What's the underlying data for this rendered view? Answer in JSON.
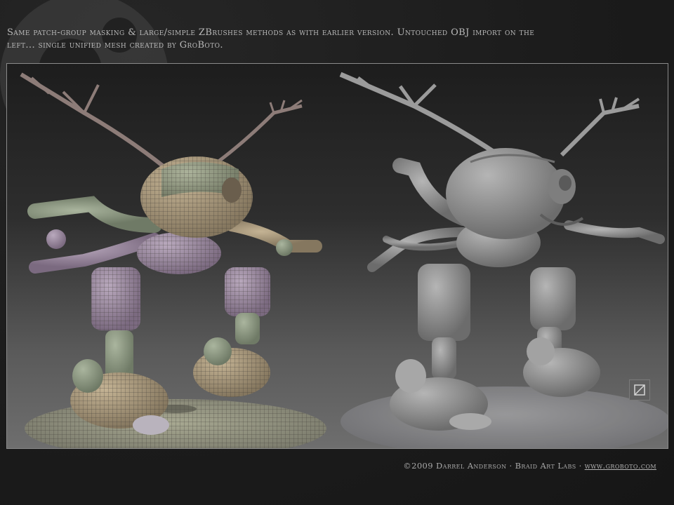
{
  "caption": {
    "line1": "Same patch-group masking & large/simple ZBrushes methods as with earlier version. Untouched OBJ import on the",
    "line2": "left... single unified mesh created by GroBoto."
  },
  "footer": {
    "copyright": "©2009 Darrel Anderson",
    "separator": "·",
    "studio": "Braid Art Labs",
    "link": "www.groboto.com"
  },
  "colors": {
    "background": "#1c1c1c",
    "text": "#b9b9b9",
    "mesh_patch_a": "#9a8aa2",
    "mesh_patch_b": "#8f9a84",
    "mesh_patch_c": "#a99a80",
    "sculpt_gray": "#8c8c8c"
  },
  "icons": {
    "viewport_badge": "frame-icon",
    "background_logo": "groboto-logo"
  }
}
